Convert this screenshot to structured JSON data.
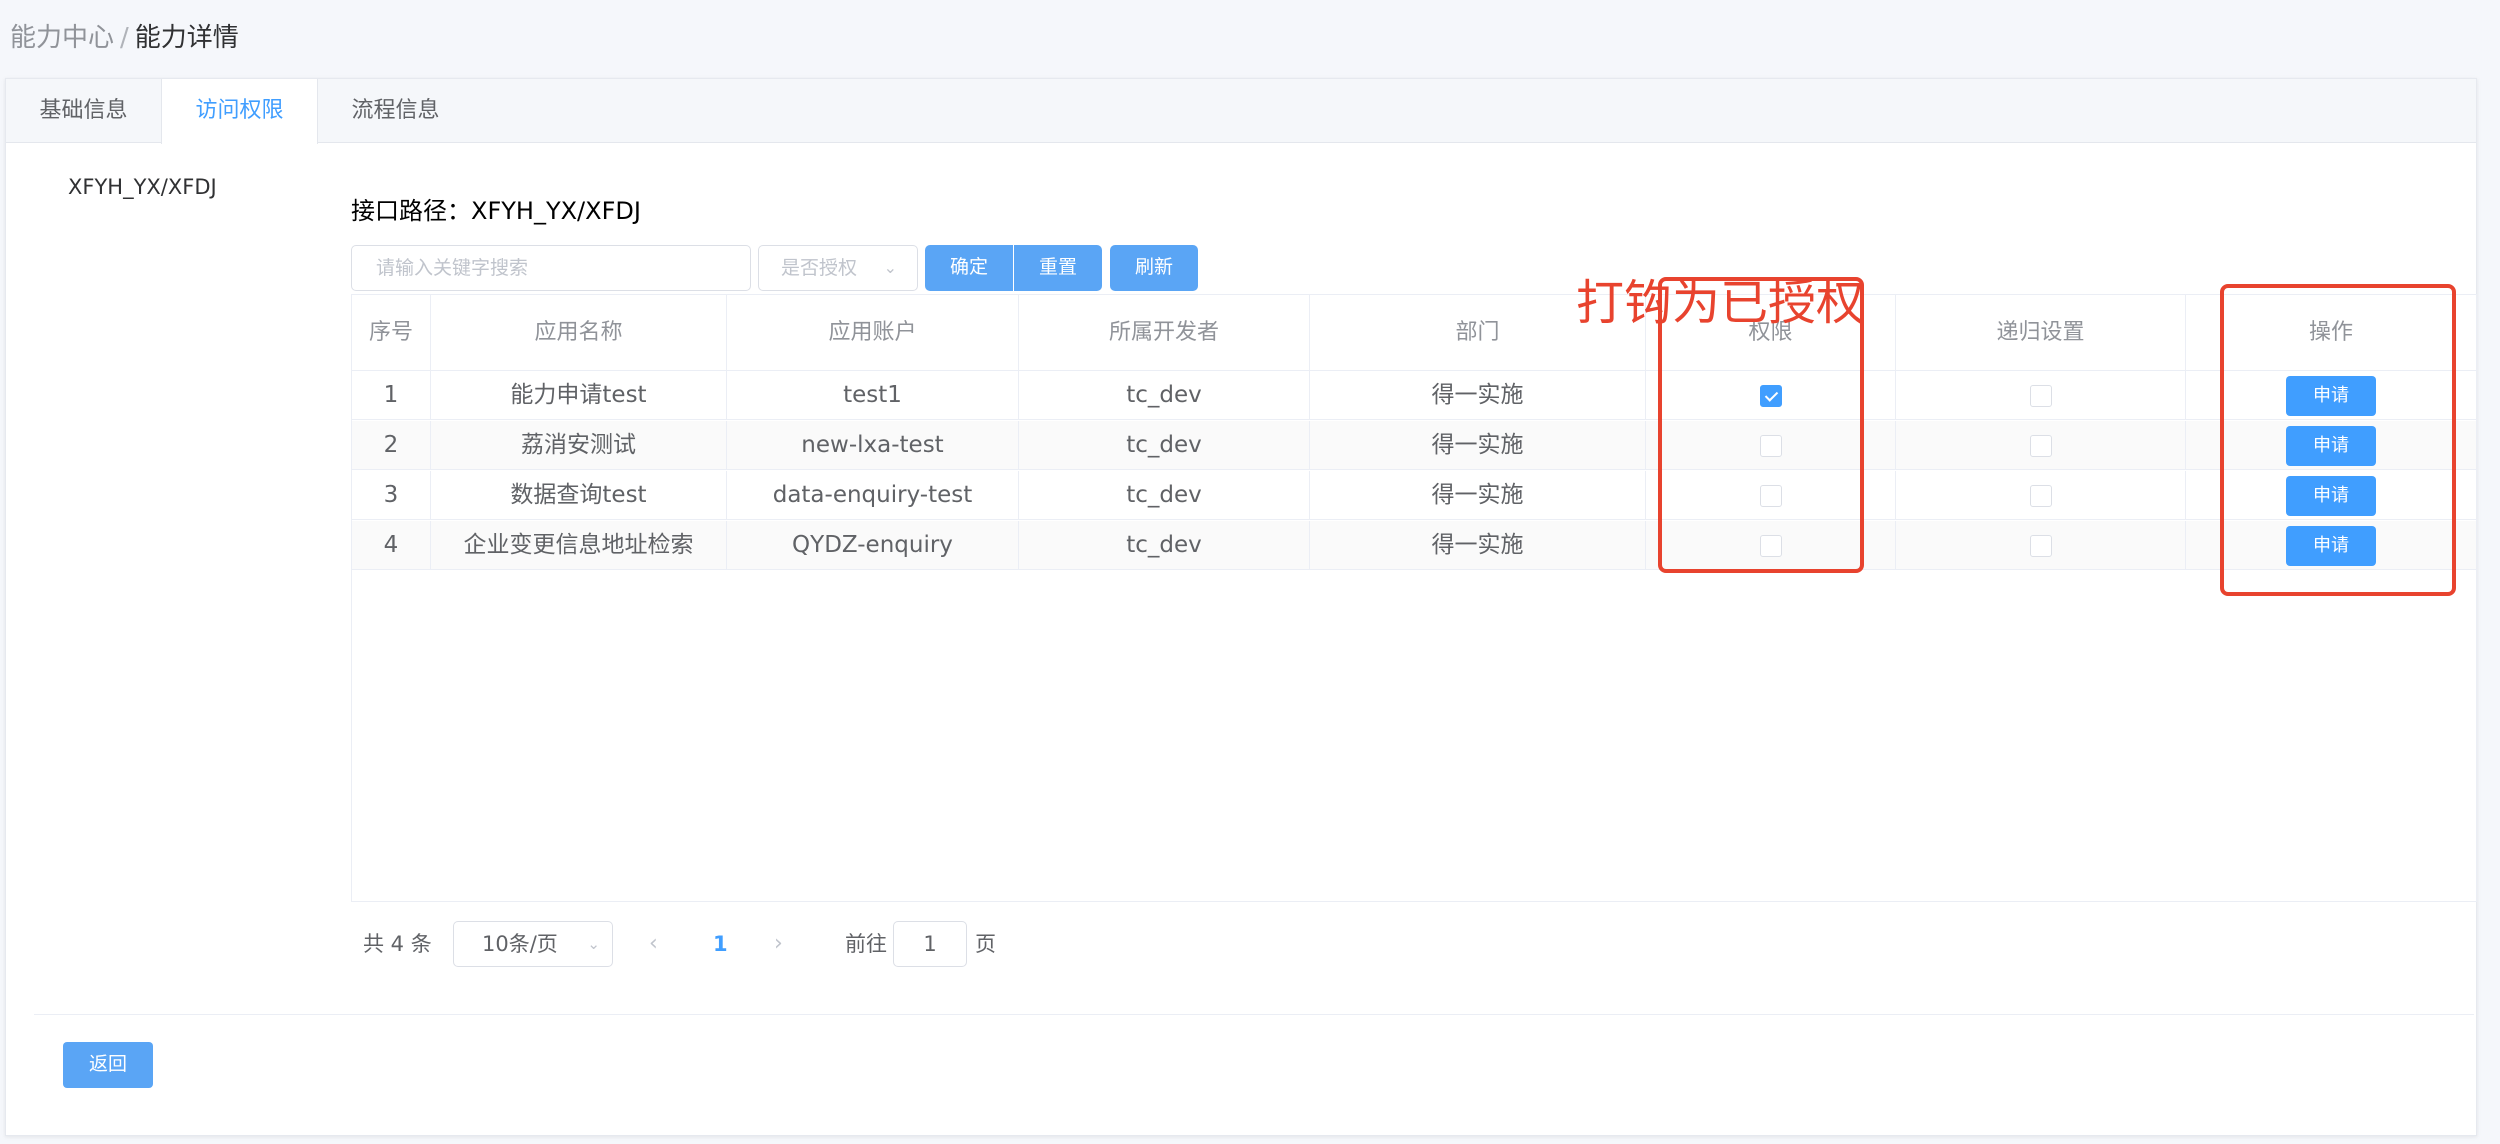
{
  "breadcrumb": {
    "parent": "能力中心",
    "separator": "/",
    "current": "能力详情"
  },
  "tabs": [
    {
      "label": "基础信息"
    },
    {
      "label": "访问权限"
    },
    {
      "label": "流程信息"
    }
  ],
  "side_path": "XFYH_YX/XFDJ",
  "api_path_label": "接口路径：XFYH_YX/XFDJ",
  "filters": {
    "search_placeholder": "请输入关键字搜索",
    "auth_select_placeholder": "是否授权",
    "confirm_label": "确定",
    "reset_label": "重置",
    "refresh_label": "刷新"
  },
  "table": {
    "headers": [
      "序号",
      "应用名称",
      "应用账户",
      "所属开发者",
      "部门",
      "权限",
      "递归设置",
      "操作"
    ],
    "rows": [
      {
        "index": "1",
        "app_name": "能力申请test",
        "account": "test1",
        "developer": "tc_dev",
        "dept": "得一实施",
        "authorized": true,
        "recursive": false,
        "action": "申请"
      },
      {
        "index": "2",
        "app_name": "荔消安测试",
        "account": "new-lxa-test",
        "developer": "tc_dev",
        "dept": "得一实施",
        "authorized": false,
        "recursive": false,
        "action": "申请"
      },
      {
        "index": "3",
        "app_name": "数据查询test",
        "account": "data-enquiry-test",
        "developer": "tc_dev",
        "dept": "得一实施",
        "authorized": false,
        "recursive": false,
        "action": "申请"
      },
      {
        "index": "4",
        "app_name": "企业变更信息地址检索",
        "account": "QYDZ-enquiry",
        "developer": "tc_dev",
        "dept": "得一实施",
        "authorized": false,
        "recursive": false,
        "action": "申请"
      }
    ]
  },
  "pagination": {
    "total": "共 4 条",
    "page_size": "10条/页",
    "current_page": "1",
    "goto_label": "前往",
    "goto_value": "1",
    "page_suffix": "页"
  },
  "back_label": "返回",
  "annotation": {
    "text": "打钩为已授权",
    "color": "#e8432e"
  },
  "colors": {
    "accent": "#409eff",
    "button": "#5aa5f5",
    "annotation": "#e8432e"
  }
}
